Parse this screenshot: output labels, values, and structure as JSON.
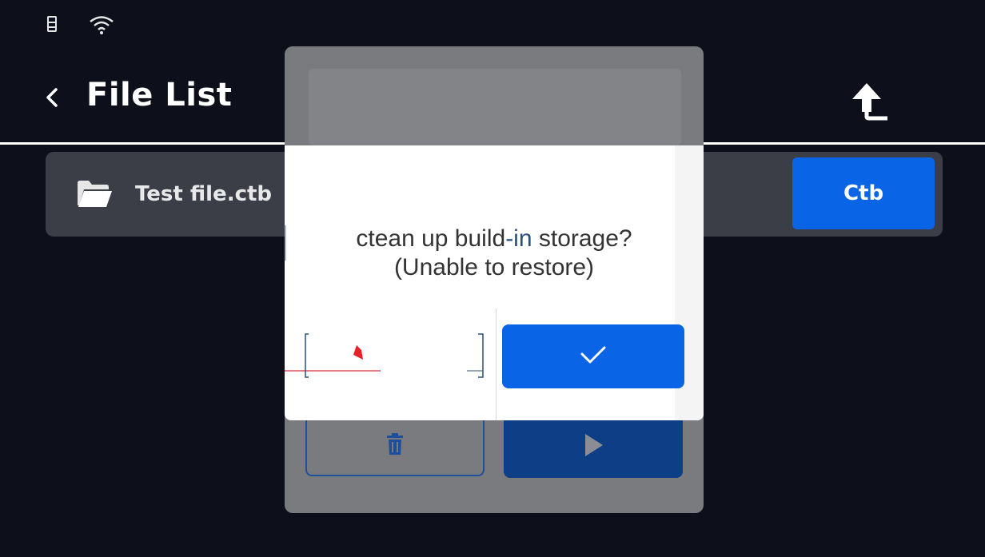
{
  "status_bar": {
    "icons": [
      "usb-drive-icon",
      "wifi-icon"
    ]
  },
  "header": {
    "back_icon": "chevron-left-icon",
    "title": "File List",
    "upload_icon": "upload-arrow-icon"
  },
  "file_list": {
    "items": [
      {
        "icon": "folder-icon",
        "name": "Test file.ctb",
        "type": "Ctb"
      }
    ]
  },
  "details_panel": {
    "delete_icon": "trash-icon",
    "print_icon": "play-icon"
  },
  "dialog": {
    "message_prefix": "ctean up build",
    "message_accent": "-in",
    "message_suffix": " storage?",
    "note": "(Unable to restore)",
    "confirm_icon": "check-icon"
  },
  "colors": {
    "background": "#0d0f1a",
    "row": "#3b3e47",
    "accent": "#0a64e6",
    "panel_dim": "#7a7b7e",
    "dialog_bg": "#ffffff",
    "dialog_text": "#333333"
  }
}
